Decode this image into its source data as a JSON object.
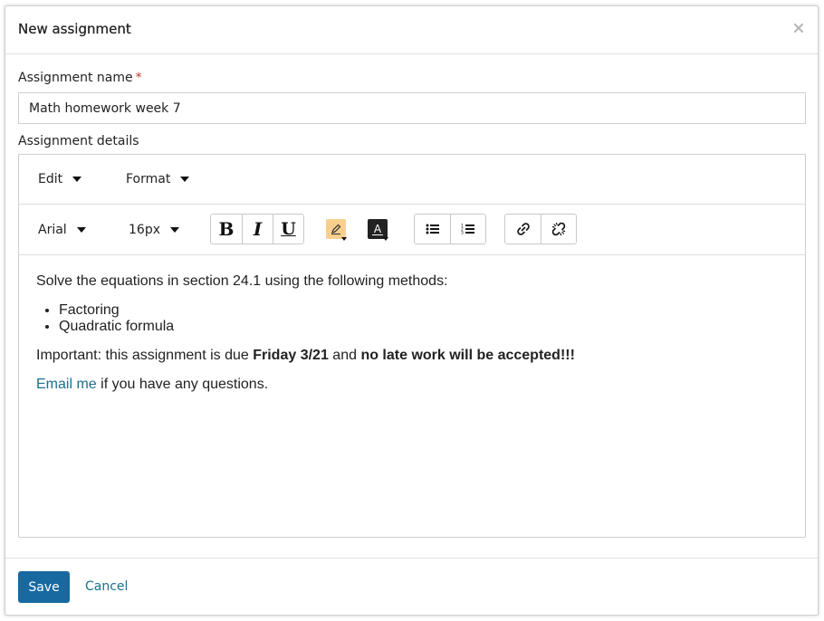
{
  "dialog": {
    "title": "New assignment",
    "close_icon": "close-icon"
  },
  "form": {
    "name_label": "Assignment name",
    "required_mark": "*",
    "name_value": "Math homework week 7",
    "details_label": "Assignment details"
  },
  "editor": {
    "menus": [
      {
        "label": "Edit"
      },
      {
        "label": "Format"
      }
    ],
    "toolbar": {
      "font_family": "Arial",
      "font_size": "16px",
      "bold_glyph": "B",
      "italic_glyph": "I",
      "underline_glyph": "U",
      "highlight_color": "#f9cf8f",
      "text_color": "#222222",
      "text_color_glyph": "A",
      "icons": [
        "highlight-icon",
        "text-color-icon",
        "bullet-list-icon",
        "numbered-list-icon",
        "link-icon",
        "unlink-icon"
      ]
    },
    "content": {
      "intro": "Solve the equations in section 24.1 using the following methods:",
      "methods": [
        "Factoring",
        "Quadratic formula"
      ],
      "important_prefix": "Important: this assignment is due ",
      "due_date": "Friday 3/21",
      "important_middle": " and ",
      "late_warning": "no late work will be accepted!!!",
      "email_link": "Email me",
      "email_suffix": " if you have any questions."
    }
  },
  "footer": {
    "save_label": "Save",
    "cancel_label": "Cancel"
  },
  "colors": {
    "primary": "#1769a0",
    "link": "#1a6f8f",
    "required": "#c0392b"
  }
}
